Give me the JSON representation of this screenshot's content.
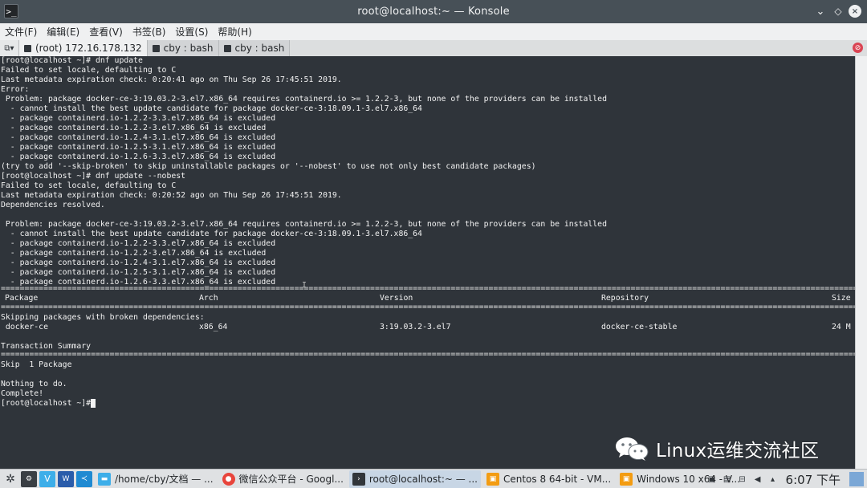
{
  "window": {
    "title": "root@localhost:~ — Konsole",
    "app_icon": "terminal-icon",
    "controls": {
      "minimize": "⌄",
      "maximize": "◇",
      "close": "×"
    }
  },
  "menu": [
    "文件(F)",
    "编辑(E)",
    "查看(V)",
    "书签(B)",
    "设置(S)",
    "帮助(H)"
  ],
  "tabs": [
    {
      "label": "(root) 172.16.178.132",
      "active": true
    },
    {
      "label": "cby : bash",
      "active": false
    },
    {
      "label": "cby : bash",
      "active": false
    }
  ],
  "terminal": {
    "lines": [
      "[root@localhost ~]# dnf update",
      "Failed to set locale, defaulting to C",
      "Last metadata expiration check: 0:20:41 ago on Thu Sep 26 17:45:51 2019.",
      "Error:",
      " Problem: package docker-ce-3:19.03.2-3.el7.x86_64 requires containerd.io >= 1.2.2-3, but none of the providers can be installed",
      "  - cannot install the best update candidate for package docker-ce-3:18.09.1-3.el7.x86_64",
      "  - package containerd.io-1.2.2-3.3.el7.x86_64 is excluded",
      "  - package containerd.io-1.2.2-3.el7.x86_64 is excluded",
      "  - package containerd.io-1.2.4-3.1.el7.x86_64 is excluded",
      "  - package containerd.io-1.2.5-3.1.el7.x86_64 is excluded",
      "  - package containerd.io-1.2.6-3.3.el7.x86_64 is excluded",
      "(try to add '--skip-broken' to skip uninstallable packages or '--nobest' to use not only best candidate packages)",
      "[root@localhost ~]# dnf update --nobest",
      "Failed to set locale, defaulting to C",
      "Last metadata expiration check: 0:20:52 ago on Thu Sep 26 17:45:51 2019.",
      "Dependencies resolved.",
      "",
      " Problem: package docker-ce-3:19.03.2-3.el7.x86_64 requires containerd.io >= 1.2.2-3, but none of the providers can be installed",
      "  - cannot install the best update candidate for package docker-ce-3:18.09.1-3.el7.x86_64",
      "  - package containerd.io-1.2.2-3.3.el7.x86_64 is excluded",
      "  - package containerd.io-1.2.2-3.el7.x86_64 is excluded",
      "  - package containerd.io-1.2.4-3.1.el7.x86_64 is excluded",
      "  - package containerd.io-1.2.5-3.1.el7.x86_64 is excluded",
      "  - package containerd.io-1.2.6-3.3.el7.x86_64 is excluded"
    ],
    "separator": "================================================================================================================================================================================================================",
    "table_headers": {
      "package": "Package",
      "arch": "Arch",
      "version": "Version",
      "repository": "Repository",
      "size": "Size"
    },
    "skipping_label": "Skipping packages with broken dependencies:",
    "row": {
      "package": " docker-ce",
      "arch": "x86_64",
      "version": "3:19.03.2-3.el7",
      "repository": "docker-ce-stable",
      "size": "24 M"
    },
    "transaction_summary": "Transaction Summary",
    "tail_lines": [
      "Skip  1 Package",
      "",
      "Nothing to do.",
      "Complete!",
      "[root@localhost ~]# "
    ]
  },
  "watermark": "Linux运维交流社区",
  "taskbar": {
    "tasks": [
      {
        "label": "/home/cby/文档 — ...",
        "icon": "folder-icon",
        "color": "#3daee9"
      },
      {
        "label": "微信公众平台 - Googl...",
        "icon": "chrome-icon",
        "color": "#e8453c"
      },
      {
        "label": "root@localhost:~ — ...",
        "icon": "terminal-icon",
        "color": "#31363b",
        "active": true
      },
      {
        "label": "Centos 8 64-bit - VM...",
        "icon": "vmware-icon",
        "color": "#f39c12"
      },
      {
        "label": "Windows 10 x64 - V...",
        "icon": "vmware-icon",
        "color": "#f39c12"
      }
    ],
    "clock": "6:07 下午"
  }
}
